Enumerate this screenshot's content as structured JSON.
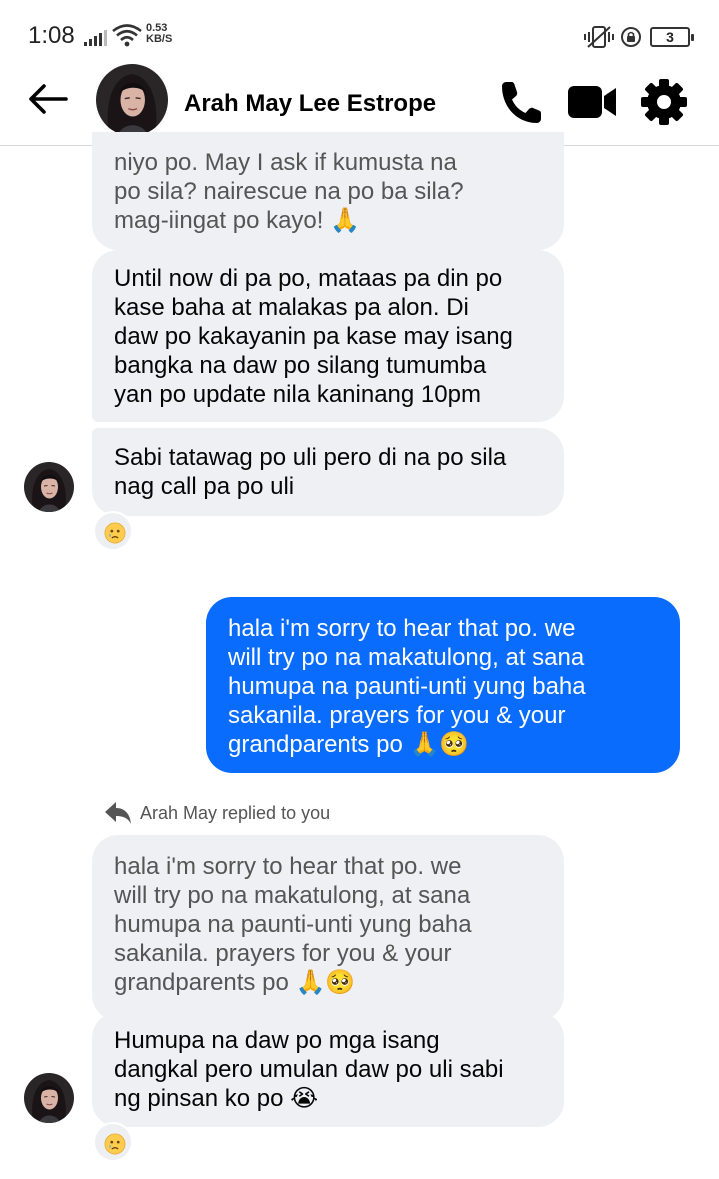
{
  "status_bar": {
    "time": "1:08",
    "net_speed_value": "0.53",
    "net_speed_unit": "KB/S",
    "battery": "3"
  },
  "header": {
    "contact_name": "Arah May Lee Estrope"
  },
  "messages": [
    {
      "direction": "incoming",
      "lines": [
        "niyo po. May I ask if kumusta na",
        "po sila? nairescue na po ba sila?",
        "mag-iingat po kayo! 🙏"
      ]
    },
    {
      "direction": "incoming",
      "lines": [
        "Until now di pa po, mataas pa din po",
        "kase baha at malakas pa alon. Di",
        "daw po kakayanin pa kase may isang",
        "bangka na daw po silang tumumba",
        "yan po update nila kaninang 10pm"
      ]
    },
    {
      "direction": "incoming",
      "lines": [
        "Sabi tatawag po uli pero di na po sila",
        "nag call pa po uli"
      ],
      "reaction": "😢"
    },
    {
      "direction": "outgoing",
      "lines": [
        "hala i'm sorry to hear that po. we",
        "will try po na makatulong, at sana",
        "humupa na paunti-unti yung baha",
        "sakanila. prayers for you & your",
        "grandparents po 🙏🥺"
      ]
    },
    {
      "direction": "incoming",
      "quoted": true,
      "lines": [
        "hala i'm sorry to hear that po. we",
        "will try po na makatulong, at sana",
        "humupa na paunti-unti yung baha",
        "sakanila. prayers for you & your",
        "grandparents po 🙏🥺"
      ]
    },
    {
      "direction": "incoming",
      "lines": [
        "Humupa na daw po mga isang",
        "dangkal pero umulan daw po uli sabi",
        "ng pinsan ko po 😭"
      ],
      "reaction": "😢"
    }
  ],
  "reply_note": "Arah May replied to you",
  "colors": {
    "outgoing_bubble": "#0a6cfc",
    "incoming_bubble": "#eff0f4"
  }
}
